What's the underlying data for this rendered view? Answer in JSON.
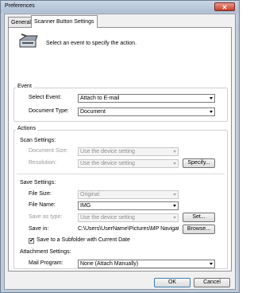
{
  "window": {
    "title": "Preferences",
    "close_glyph": "✕"
  },
  "tabs": [
    {
      "label": "General"
    },
    {
      "label": "Scanner Button Settings"
    }
  ],
  "header": {
    "instruction": "Select an event to specify the action.",
    "icon": "scanner-icon"
  },
  "event": {
    "group_label": "Event",
    "select_event_label": "Select Event:",
    "select_event_value": "Attach to E-mail",
    "document_type_label": "Document Type:",
    "document_type_value": "Document"
  },
  "actions": {
    "group_label": "Actions",
    "scan_settings_label": "Scan Settings:",
    "document_size_label": "Document Size:",
    "document_size_value": "Use the device setting",
    "resolution_label": "Resolution:",
    "resolution_value": "Use the device setting",
    "specify_button": "Specify...",
    "save_settings_label": "Save Settings:",
    "file_size_label": "File Size:",
    "file_size_value": "Original",
    "file_name_label": "File Name:",
    "file_name_value": "IMG",
    "save_as_type_label": "Save as type:",
    "save_as_type_value": "Use the device setting",
    "set_button": "Set...",
    "save_in_label": "Save in:",
    "save_in_value": "C:\\Users\\UserName\\Pictures\\MP Navigat",
    "browse_button": "Browse...",
    "subfolder_label": "Save to a Subfolder with Current Date",
    "subfolder_checked": true,
    "attachment_settings_label": "Attachment Settings:",
    "mail_program_label": "Mail Program:",
    "mail_program_value": "None (Attach Manually)"
  },
  "footer": {
    "ok_button": "OK",
    "cancel_button": "Cancel"
  }
}
